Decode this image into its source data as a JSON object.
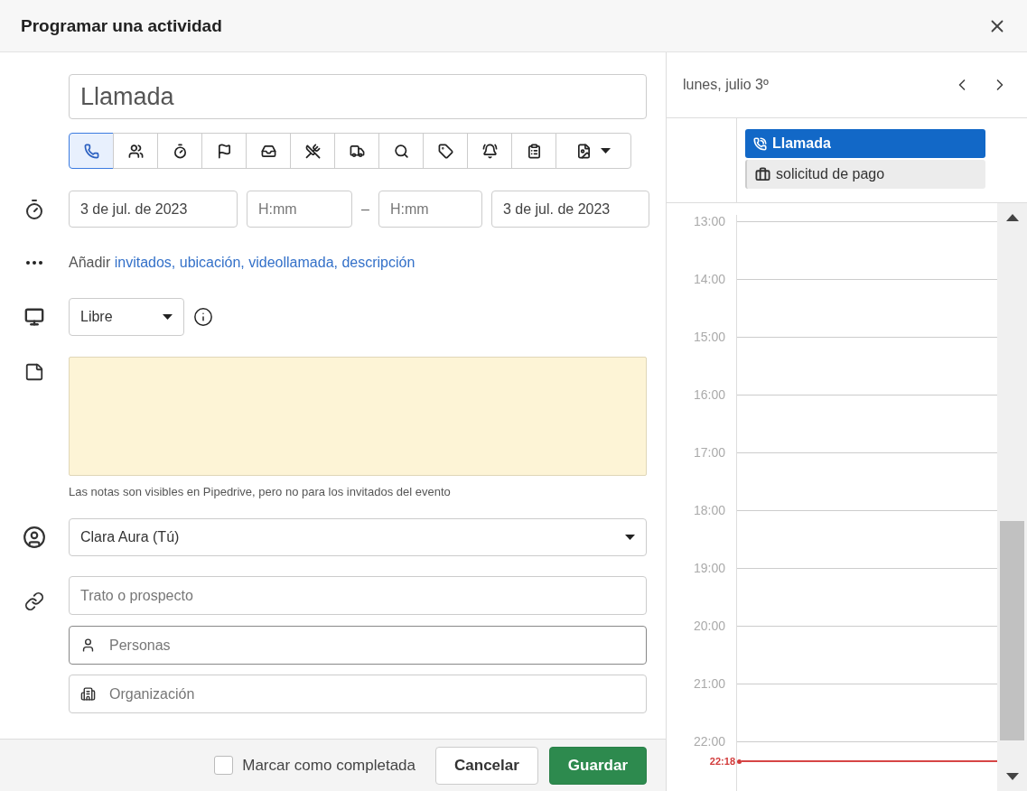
{
  "dialog": {
    "title": "Programar una actividad"
  },
  "subject": {
    "value": "Llamada"
  },
  "activity_types": [
    {
      "kind": "call",
      "selected": true
    },
    {
      "kind": "meeting",
      "selected": false
    },
    {
      "kind": "deadline",
      "selected": false
    },
    {
      "kind": "flag",
      "selected": false
    },
    {
      "kind": "inbox",
      "selected": false
    },
    {
      "kind": "lunch",
      "selected": false
    },
    {
      "kind": "delivery",
      "selected": false
    },
    {
      "kind": "search",
      "selected": false
    },
    {
      "kind": "tag",
      "selected": false
    },
    {
      "kind": "alarm",
      "selected": false
    },
    {
      "kind": "task",
      "selected": false
    },
    {
      "kind": "document",
      "selected": false
    }
  ],
  "schedule": {
    "start_date": "3 de jul. de 2023",
    "start_time_placeholder": "H:mm",
    "separator": "–",
    "end_time_placeholder": "H:mm",
    "end_date": "3 de jul. de 2023"
  },
  "add_more": {
    "prefix": "Añadir",
    "links": [
      "invitados,",
      "ubicación,",
      "videollamada,",
      "descripción"
    ]
  },
  "busy": {
    "value": "Libre"
  },
  "notes": {
    "hint": "Las notas son visibles en Pipedrive, pero no para los invitados del evento"
  },
  "owner": {
    "value": "Clara Aura (Tú)"
  },
  "related": [
    {
      "kind": "deal",
      "placeholder": "Trato o prospecto",
      "focused": false
    },
    {
      "kind": "person",
      "placeholder": "Personas",
      "focused": true
    },
    {
      "kind": "organization",
      "placeholder": "Organización",
      "focused": false
    }
  ],
  "footer": {
    "done_label": "Marcar como completada",
    "done_checked": false,
    "buttons": [
      "Cancelar",
      "Guardar"
    ]
  },
  "calendar": {
    "date": "lunes, julio 3º",
    "events": [
      {
        "kind": "call",
        "title": "Llamada",
        "selected": true
      },
      {
        "kind": "deal",
        "title": "solicitud de pago",
        "selected": false
      }
    ],
    "hours": [
      "13:00",
      "14:00",
      "15:00",
      "16:00",
      "17:00",
      "18:00",
      "19:00",
      "20:00",
      "21:00",
      "22:00"
    ],
    "now": "22:18"
  }
}
